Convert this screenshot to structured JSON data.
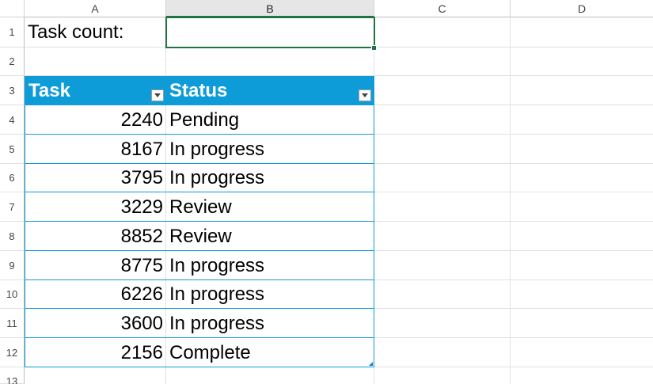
{
  "columns": [
    "A",
    "B",
    "C",
    "D"
  ],
  "rows": [
    "1",
    "2",
    "3",
    "4",
    "5",
    "6",
    "7",
    "8",
    "9",
    "10",
    "11",
    "12",
    "13"
  ],
  "cells": {
    "a1": "Task count:",
    "b1": ""
  },
  "table": {
    "headers": [
      "Task",
      "Status"
    ],
    "header_color": "#0e9cd8",
    "rows": [
      {
        "task": "2240",
        "status": "Pending"
      },
      {
        "task": "8167",
        "status": "In progress"
      },
      {
        "task": "3795",
        "status": "In progress"
      },
      {
        "task": "3229",
        "status": "Review"
      },
      {
        "task": "8852",
        "status": "Review"
      },
      {
        "task": "8775",
        "status": "In progress"
      },
      {
        "task": "6226",
        "status": "In progress"
      },
      {
        "task": "3600",
        "status": "In progress"
      },
      {
        "task": "2156",
        "status": "Complete"
      }
    ]
  },
  "selection": {
    "cell": "B1",
    "color": "#217346"
  }
}
